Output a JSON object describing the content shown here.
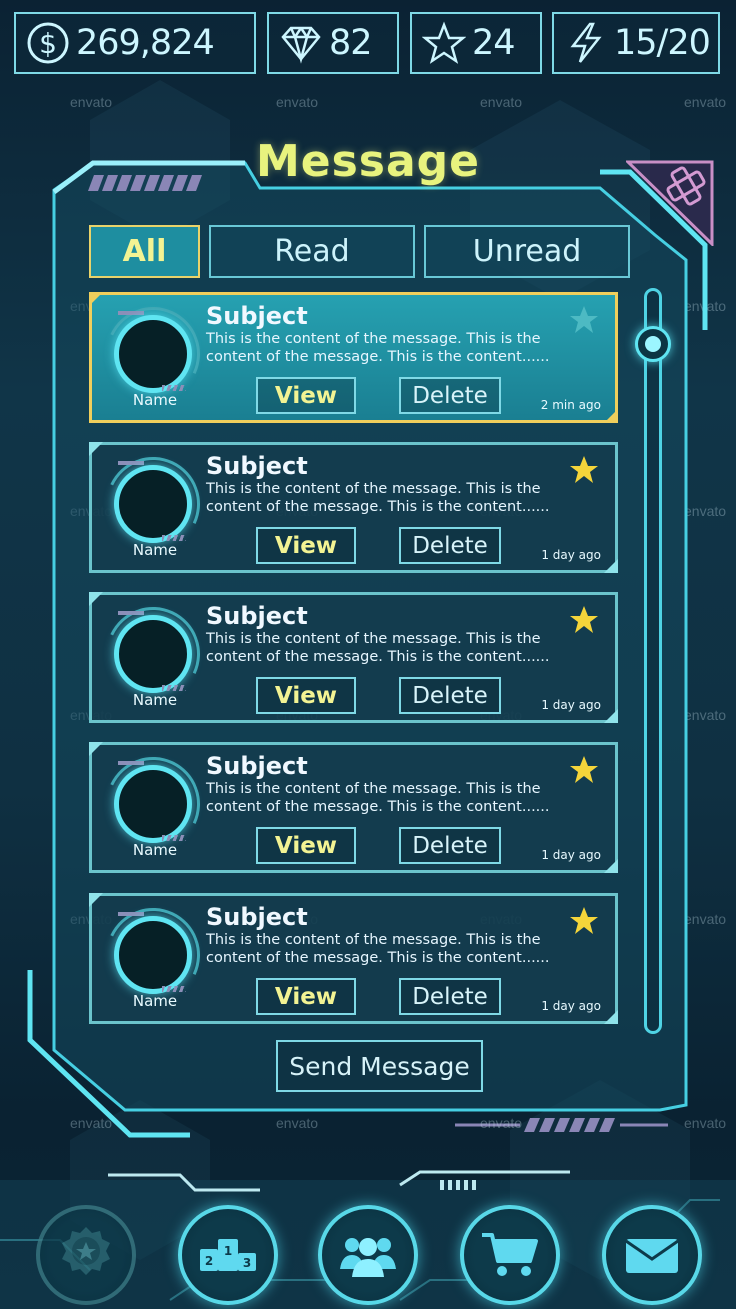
{
  "resources": {
    "coins": "269,824",
    "gems": "82",
    "stars": "24",
    "energy": "15/20"
  },
  "title": "Message",
  "tabs": [
    {
      "label": "All",
      "active": true
    },
    {
      "label": "Read",
      "active": false
    },
    {
      "label": "Unread",
      "active": false
    }
  ],
  "watermark": "envato",
  "messages": [
    {
      "subject": "Subject",
      "body": "This is the content of the message. This is the content of the message. This is the content......",
      "name": "Name",
      "view": "View",
      "delete": "Delete",
      "time": "2 min ago",
      "starred": false,
      "selected": true
    },
    {
      "subject": "Subject",
      "body": "This is the content of the message. This is the content of the message. This is the content......",
      "name": "Name",
      "view": "View",
      "delete": "Delete",
      "time": "1 day ago",
      "starred": true,
      "selected": false
    },
    {
      "subject": "Subject",
      "body": "This is the content of the message. This is the content of the message. This is the content......",
      "name": "Name",
      "view": "View",
      "delete": "Delete",
      "time": "1 day ago",
      "starred": true,
      "selected": false
    },
    {
      "subject": "Subject",
      "body": "This is the content of the message. This is the content of the message. This is the content......",
      "name": "Name",
      "view": "View",
      "delete": "Delete",
      "time": "1 day ago",
      "starred": true,
      "selected": false
    },
    {
      "subject": "Subject",
      "body": "This is the content of the message. This is the content of the message. This is the content......",
      "name": "Name",
      "view": "View",
      "delete": "Delete",
      "time": "1 day ago",
      "starred": true,
      "selected": false
    }
  ],
  "send_label": "Send Message",
  "bottom_nav": [
    {
      "icon": "achievement-medal-icon"
    },
    {
      "icon": "leaderboard-podium-icon"
    },
    {
      "icon": "friends-icon"
    },
    {
      "icon": "shop-cart-icon"
    },
    {
      "icon": "mail-icon"
    }
  ],
  "podium_numbers": [
    "2",
    "1",
    "3"
  ],
  "colors": {
    "accent": "#5fe5f2",
    "title": "#e8f37e",
    "selected_border": "#f0cf5c",
    "star": "#f5d53a",
    "close": "#c98fc6"
  }
}
